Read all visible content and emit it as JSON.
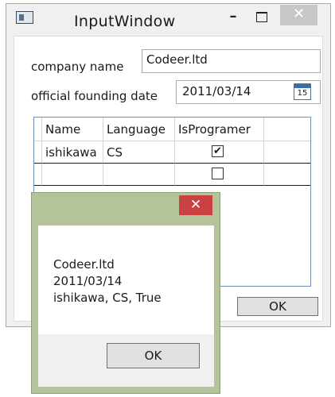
{
  "main_window": {
    "title": "InputWindow",
    "minimize_glyph": "–",
    "close_glyph": "✕",
    "icon": "app-window-icon"
  },
  "form": {
    "company_label": "company name",
    "company_value": "Codeer.ltd",
    "date_label": "official founding date",
    "date_value": "2011/03/14",
    "calendar_icon_day": "15"
  },
  "grid": {
    "columns": [
      "Name",
      "Language",
      "IsProgramer"
    ],
    "rows": [
      {
        "name": "ishikawa",
        "language": "CS",
        "is_programer": true
      },
      {
        "name": "",
        "language": "",
        "is_programer": false
      }
    ]
  },
  "main_ok_label": "OK",
  "message_box": {
    "close_glyph": "✕",
    "lines": [
      "Codeer.ltd",
      "2011/03/14",
      "ishikawa, CS, True"
    ],
    "ok_label": "OK"
  },
  "colors": {
    "message_box_frame": "#b4c39a",
    "message_close": "#c94242",
    "grid_border": "#6e8fb8"
  }
}
